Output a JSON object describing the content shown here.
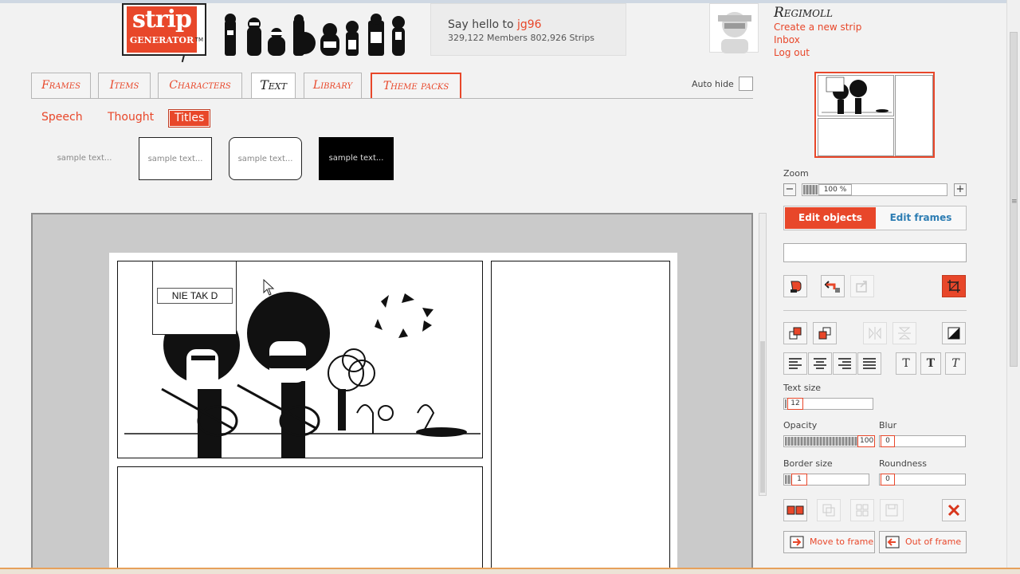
{
  "header": {
    "logo_line1": "strip",
    "logo_line2": "GENERATOR",
    "logo_tm": "TM",
    "hello_prefix": "Say hello to ",
    "hello_user": "jg96",
    "stats": "329,122 Members 802,926 Strips"
  },
  "user": {
    "name": "Regimoll",
    "links": [
      "Create a new strip",
      "Inbox",
      "Log out"
    ]
  },
  "tabs": [
    "Frames",
    "Items",
    "Characters",
    "Text",
    "Library",
    "Theme packs"
  ],
  "active_tab": "Text",
  "autohide_label": "Auto hide",
  "subtabs": [
    "Speech",
    "Thought",
    "Titles"
  ],
  "active_subtab": "Titles",
  "samples": [
    "sample text...",
    "sample text...",
    "sample text...",
    "sample text..."
  ],
  "canvas": {
    "title_text": "NIE TAK D"
  },
  "panel": {
    "zoom_label": "Zoom",
    "zoom_value": "100 %",
    "zoom_minus": "−",
    "zoom_plus": "+",
    "mode_edit_objects": "Edit objects",
    "mode_edit_frames": "Edit frames",
    "text_size_label": "Text size",
    "text_size_value": "12",
    "opacity_label": "Opacity",
    "opacity_value": "100",
    "blur_label": "Blur",
    "blur_value": "0",
    "border_size_label": "Border size",
    "border_size_value": "1",
    "roundness_label": "Roundness",
    "roundness_value": "0",
    "move_to_frame": "Move to frame",
    "out_of_frame": "Out of frame",
    "font_style_glyph": "T"
  },
  "colors": {
    "accent": "#e8472a",
    "link_blue": "#2d7db3"
  }
}
